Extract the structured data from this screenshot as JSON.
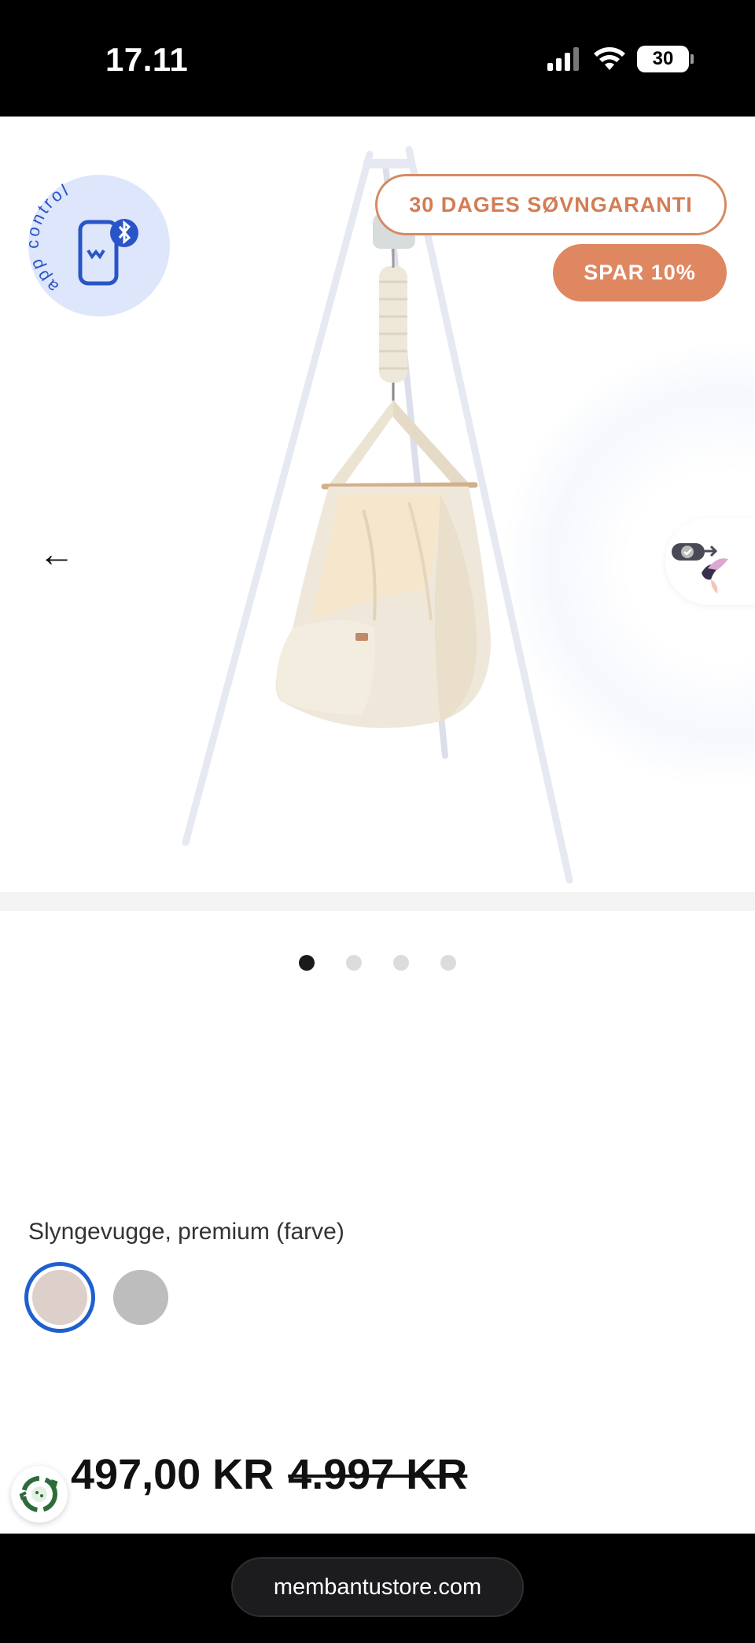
{
  "status_bar": {
    "time": "17.11",
    "battery_level": "30",
    "icons": [
      "cellular-signal-icon",
      "wifi-icon",
      "battery-icon"
    ]
  },
  "gallery": {
    "app_badge_text": "app control",
    "badge_guarantee": "30 DAGES SØVNGARANTI",
    "badge_save": "SPAR 10%",
    "prev_arrow": "←",
    "slides_total": 4,
    "active_slide": 1
  },
  "colors": {
    "accent_orange": "#de8760",
    "badge_border": "#d58a63",
    "app_badge_bg": "#dde6fb",
    "selected_ring": "#1f5fd0",
    "swatch_natural": "#ddcfca",
    "swatch_grey": "#bdbdbd"
  },
  "variant": {
    "label": "Slyngevugge, premium (farve)",
    "options": [
      {
        "name": "natural",
        "selected": true
      },
      {
        "name": "grey",
        "selected": false
      }
    ]
  },
  "price": {
    "current": "497,00 KR",
    "original": "4.997 KR"
  },
  "browser": {
    "url": "membantustore.com"
  }
}
